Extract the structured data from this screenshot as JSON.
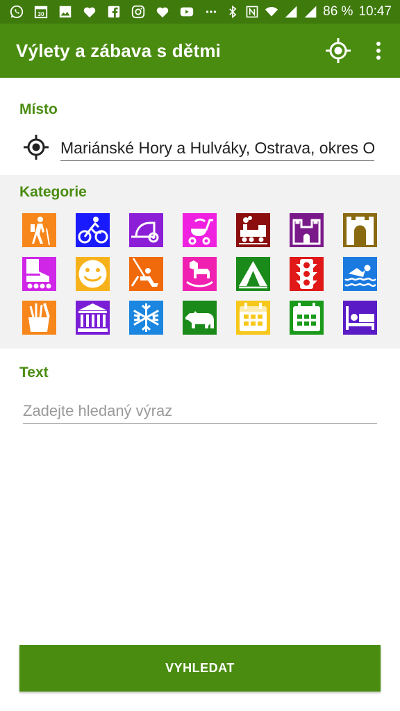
{
  "status_bar": {
    "icons": [
      "whatsapp-icon",
      "calendar-icon",
      "image-icon",
      "heart-icon",
      "facebook-icon",
      "instagram-icon",
      "heart-icon",
      "youtube-icon",
      "more-dots-icon"
    ],
    "calendar_day": "30",
    "battery": "86 %",
    "time": "10:47"
  },
  "app_bar": {
    "title": "Výlety a zábava s dětmi"
  },
  "location": {
    "label": "Místo",
    "value": "Mariánské Hory a Hulváky, Ostrava, okres Ostrava-město"
  },
  "categories": {
    "label": "Kategorie",
    "items": [
      {
        "icon": "hiking-icon",
        "color": "#f7861b"
      },
      {
        "icon": "cycling-icon",
        "color": "#1a1aff"
      },
      {
        "icon": "bike-trailer-icon",
        "color": "#8b1ed6"
      },
      {
        "icon": "stroller-icon",
        "color": "#f020e0"
      },
      {
        "icon": "steam-train-icon",
        "color": "#8b0d0d"
      },
      {
        "icon": "castle-icon",
        "color": "#7a1a8a"
      },
      {
        "icon": "fortress-gate-icon",
        "color": "#8a6a10"
      },
      {
        "icon": "inline-skate-icon",
        "color": "#d026e8"
      },
      {
        "icon": "smiley-icon",
        "color": "#f7b21b"
      },
      {
        "icon": "swing-icon",
        "color": "#f06a0c"
      },
      {
        "icon": "rocking-horse-icon",
        "color": "#f020b0"
      },
      {
        "icon": "tent-icon",
        "color": "#1a8a1a"
      },
      {
        "icon": "traffic-light-icon",
        "color": "#e01818"
      },
      {
        "icon": "swimming-icon",
        "color": "#1a7ae0"
      },
      {
        "icon": "art-supplies-icon",
        "color": "#f7861b"
      },
      {
        "icon": "museum-icon",
        "color": "#7a1ed6"
      },
      {
        "icon": "snowflake-icon",
        "color": "#1a86e0"
      },
      {
        "icon": "bear-icon",
        "color": "#1a8a1a"
      },
      {
        "icon": "calendar-yellow-icon",
        "color": "#f7c81b"
      },
      {
        "icon": "calendar-green-icon",
        "color": "#1a9a1a"
      },
      {
        "icon": "bed-icon",
        "color": "#5a1ac6"
      }
    ]
  },
  "text": {
    "label": "Text",
    "placeholder": "Zadejte hledaný výraz"
  },
  "search_button": {
    "label": "VYHLEDAT"
  },
  "colors": {
    "status_bar": "#3e7a0c",
    "app_bar": "#4a8c10",
    "accent": "#4a8c10",
    "panel": "#f2f2f2"
  }
}
